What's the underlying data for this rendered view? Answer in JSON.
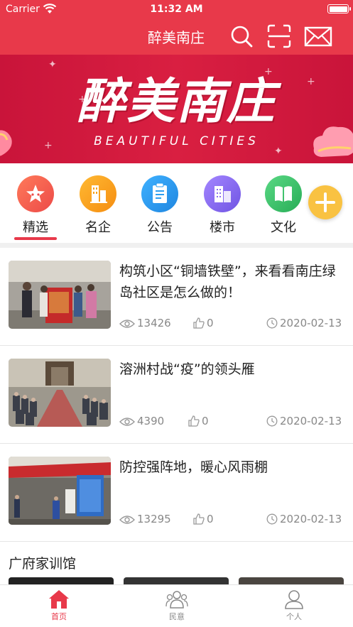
{
  "status_bar": {
    "carrier": "Carrier",
    "time": "11:32 AM"
  },
  "header": {
    "title": "醉美南庄",
    "icons": [
      "search-icon",
      "scan-icon",
      "mail-icon"
    ],
    "color": "#e8394a"
  },
  "banner": {
    "title": "醉美南庄",
    "subtitle": "BEAUTIFUL CITIES"
  },
  "categories": [
    {
      "label": "精选",
      "icon": "star-icon",
      "color": "#f0604e",
      "active": true
    },
    {
      "label": "名企",
      "icon": "building-icon",
      "color": "#f7a21b"
    },
    {
      "label": "公告",
      "icon": "clipboard-icon",
      "color": "#2d9ef0"
    },
    {
      "label": "楼市",
      "icon": "city-icon",
      "color": "#8a6cf0"
    },
    {
      "label": "文化",
      "icon": "book-icon",
      "color": "#3cc46a"
    }
  ],
  "add_button": {
    "icon": "plus-icon",
    "color": "#f9c242"
  },
  "news": [
    {
      "title": "构筑小区“铜墙铁壁”，来看看南庄绿岛社区是怎么做的！",
      "views": "13426",
      "likes": "0",
      "date": "2020-02-13"
    },
    {
      "title": "溶洲村战“疫”的领头雁",
      "views": "4390",
      "likes": "0",
      "date": "2020-02-13"
    },
    {
      "title": "防控强阵地，暖心风雨棚",
      "views": "13295",
      "likes": "0",
      "date": "2020-02-13"
    }
  ],
  "section": {
    "title": "广府家训馆"
  },
  "tabbar": [
    {
      "label": "首页",
      "icon": "home-icon",
      "active": true
    },
    {
      "label": "民意",
      "icon": "people-icon"
    },
    {
      "label": "个人",
      "icon": "person-icon"
    }
  ]
}
